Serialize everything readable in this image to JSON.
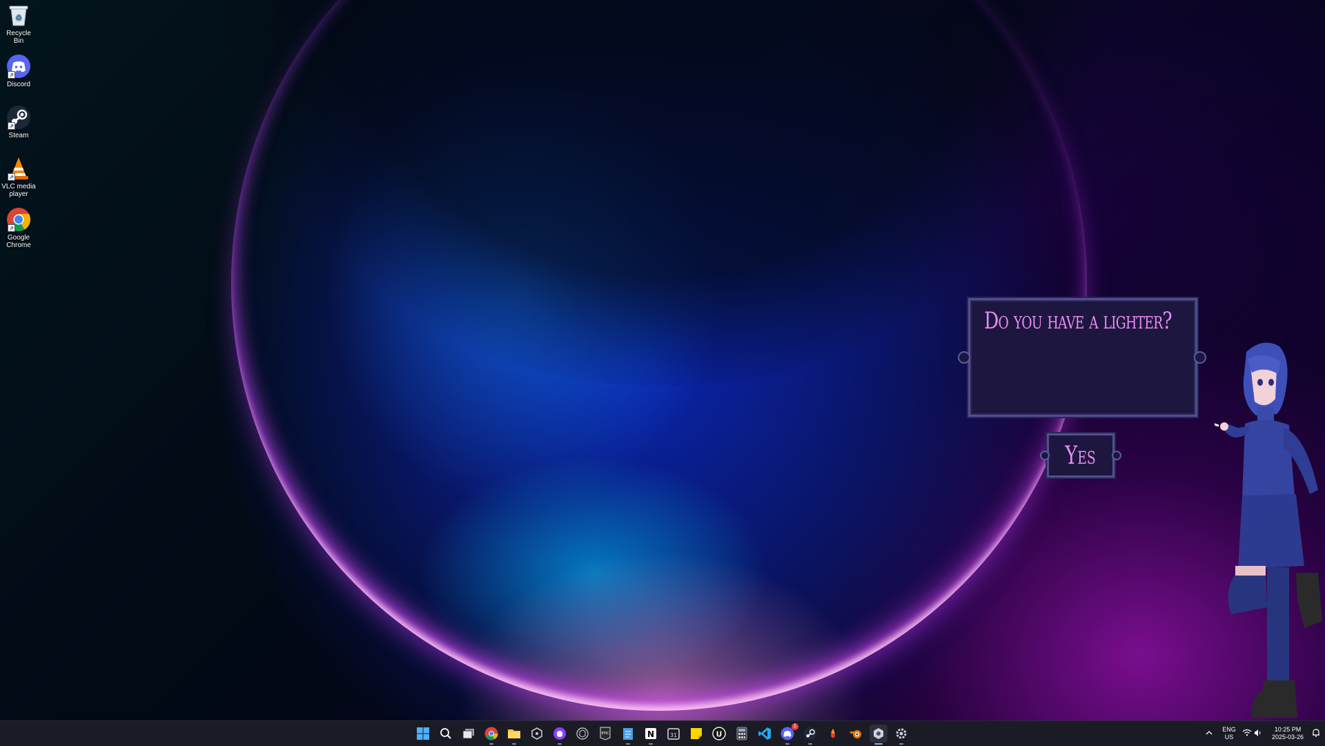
{
  "desktop_icons": [
    {
      "label": "Recycle Bin",
      "icon": "recycle-bin-icon"
    },
    {
      "label": "Discord",
      "icon": "discord-icon"
    },
    {
      "label": "Steam",
      "icon": "steam-icon"
    },
    {
      "label": "VLC media player",
      "icon": "vlc-icon"
    },
    {
      "label": "Google Chrome",
      "icon": "chrome-icon"
    }
  ],
  "dialog": {
    "question": "Do you have a lighter?",
    "answer": "Yes"
  },
  "taskbar": {
    "apps": [
      "start-icon",
      "search-icon",
      "task-view-icon",
      "chrome-icon",
      "file-explorer-icon",
      "unity-hub-icon",
      "github-desktop-icon",
      "unity-icon",
      "epic-games-icon",
      "notepad-icon",
      "notion-icon",
      "calendar-icon",
      "sticky-notes-icon",
      "unreal-engine-icon",
      "calculator-icon",
      "vs-code-icon",
      "discord-icon",
      "steam-icon",
      "fl-studio-icon",
      "blender-icon",
      "desktop-pet-app-icon",
      "settings-icon"
    ],
    "discord_badge": "1"
  },
  "tray": {
    "language": "ENG",
    "region": "US",
    "time": "10:25 PM",
    "date": "2025-03-26"
  },
  "colors": {
    "dialog_text": "#ea8cf0",
    "dialog_bg": "#1d1740",
    "dialog_border": "#51508e",
    "taskbar_bg": "#1a1b25"
  }
}
